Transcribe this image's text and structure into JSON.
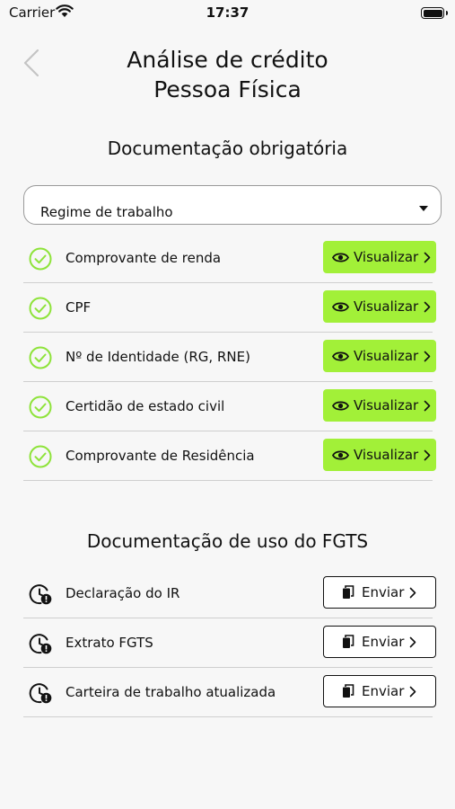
{
  "status_bar": {
    "carrier": "Carrier",
    "time": "17:37"
  },
  "header": {
    "title_line1": "Análise de crédito",
    "title_line2": "Pessoa Física"
  },
  "required_docs": {
    "title": "Documentação obrigatória",
    "select_value": "Regime de trabalho",
    "button_label": "Visualizar",
    "items": [
      {
        "label": "Comprovante de renda"
      },
      {
        "label": "CPF"
      },
      {
        "label": "Nº de Identidade (RG, RNE)"
      },
      {
        "label": "Certidão de estado civil"
      },
      {
        "label": "Comprovante de Residência"
      }
    ]
  },
  "fgts_docs": {
    "title": "Documentação de uso do FGTS",
    "button_label": "Enviar",
    "items": [
      {
        "label": "Declaração do IR"
      },
      {
        "label": "Extrato FGTS"
      },
      {
        "label": "Carteira de trabalho atualizada"
      }
    ]
  },
  "icons": {
    "check": "check-circle-icon",
    "pending": "clock-alert-icon",
    "view": "eye-icon",
    "send": "document-copy-icon",
    "back": "chevron-left-icon"
  },
  "colors": {
    "accent": "#a2f038",
    "check": "#8ee33a"
  }
}
